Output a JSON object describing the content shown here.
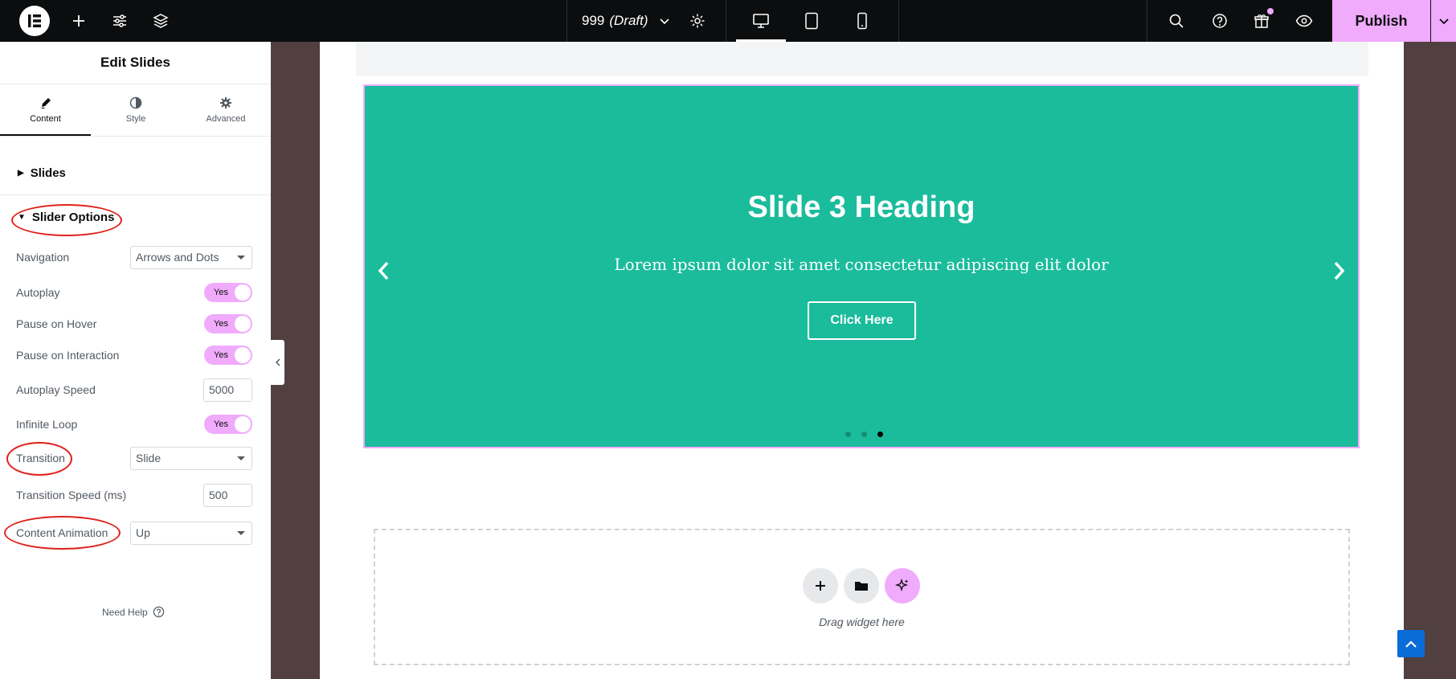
{
  "topbar": {
    "doc_name": "999",
    "doc_status": "(Draft)",
    "publish_label": "Publish"
  },
  "panel": {
    "title": "Edit Slides",
    "tabs": [
      {
        "label": "Content",
        "icon": "pencil-icon",
        "active": true
      },
      {
        "label": "Style",
        "icon": "half-circle-icon",
        "active": false
      },
      {
        "label": "Advanced",
        "icon": "gear-icon",
        "active": false
      }
    ],
    "sections": {
      "slides": "Slides",
      "slider_options": "Slider Options"
    },
    "controls": {
      "navigation": {
        "label": "Navigation",
        "value": "Arrows and Dots"
      },
      "autoplay": {
        "label": "Autoplay",
        "value": "Yes"
      },
      "pause_hover": {
        "label": "Pause on Hover",
        "value": "Yes"
      },
      "pause_interaction": {
        "label": "Pause on Interaction",
        "value": "Yes"
      },
      "autoplay_speed": {
        "label": "Autoplay Speed",
        "value": "5000"
      },
      "infinite_loop": {
        "label": "Infinite Loop",
        "value": "Yes"
      },
      "transition": {
        "label": "Transition",
        "value": "Slide"
      },
      "transition_speed": {
        "label": "Transition Speed (ms)",
        "value": "500"
      },
      "content_animation": {
        "label": "Content Animation",
        "value": "Up"
      }
    },
    "need_help": "Need Help"
  },
  "slide": {
    "heading": "Slide 3 Heading",
    "description": "Lorem ipsum dolor sit amet consectetur adipiscing elit dolor",
    "button": "Click Here",
    "active_dot": 3,
    "dot_count": 3
  },
  "dropzone": {
    "text": "Drag widget here"
  },
  "colors": {
    "accent": "#f0abfc",
    "slide_bg": "#1abc9c",
    "topbar_bg": "#0c0d0e",
    "annotation": "#e0211b"
  }
}
